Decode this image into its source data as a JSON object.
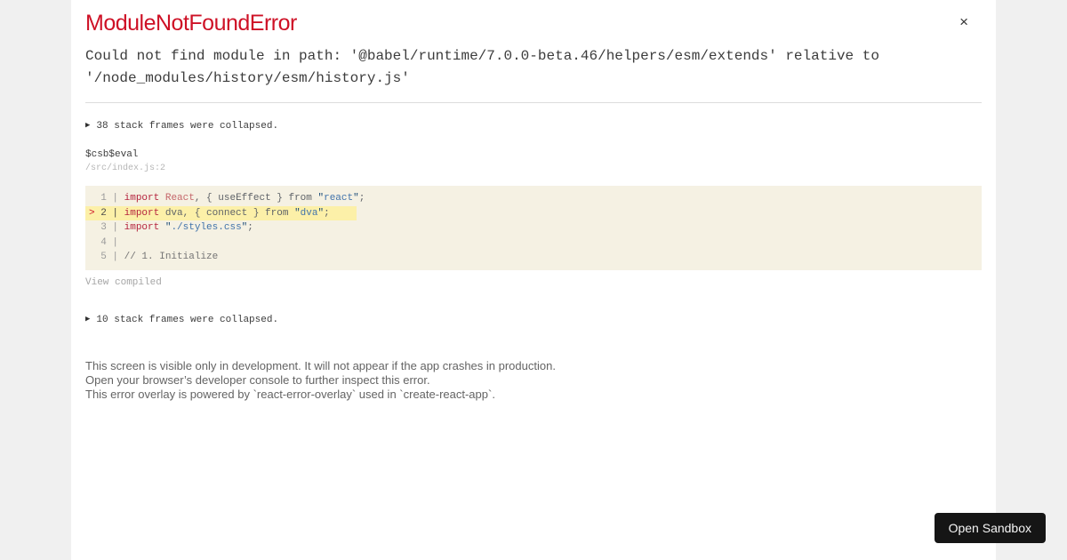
{
  "colors": {
    "page_background": "#f0f0f0",
    "dialog_background": "#ffffff",
    "error_red": "#ce1126",
    "code_frame_background": "#f5f1e3",
    "highlight_line_background": "#fcf0a8",
    "keyword_red": "#b5243e",
    "string_blue": "#4173ab",
    "button_background": "#151515"
  },
  "header": {
    "title": "ModuleNotFoundError",
    "close_label": "×"
  },
  "message": {
    "text": "Could not find module in path: '@babel/runtime/7.0.0-beta.46/helpers/esm/extends' relative to '/node_modules/history/esm/history.js'"
  },
  "stack": {
    "marker": "▶",
    "collapsed_top": "38 stack frames were collapsed.",
    "frame": {
      "function": "$csb$eval",
      "location": "/src/index.js:2"
    },
    "view_compiled": "View compiled",
    "collapsed_bottom": "10 stack frames were collapsed."
  },
  "code_frame": {
    "lines": [
      {
        "marked": false,
        "marker": " ",
        "prefix": " 1 | ",
        "tokens": [
          [
            "kw",
            "import"
          ],
          [
            "pln",
            " "
          ],
          [
            "cap",
            "React"
          ],
          [
            "pln",
            ", { useEffect } from "
          ],
          [
            "strq",
            "\""
          ],
          [
            "str",
            "react"
          ],
          [
            "strq",
            "\""
          ],
          [
            "pln",
            ";"
          ]
        ]
      },
      {
        "marked": true,
        "marker": ">",
        "prefix": " 2 | ",
        "tokens": [
          [
            "kw",
            "import"
          ],
          [
            "pln",
            " dva, { connect } from "
          ],
          [
            "strq",
            "\""
          ],
          [
            "str",
            "dva"
          ],
          [
            "strq",
            "\""
          ],
          [
            "pln",
            ";"
          ]
        ]
      },
      {
        "marked": false,
        "marker": " ",
        "prefix": " 3 | ",
        "tokens": [
          [
            "kw",
            "import"
          ],
          [
            "pln",
            " "
          ],
          [
            "strq",
            "\""
          ],
          [
            "str",
            "./styles.css"
          ],
          [
            "strq",
            "\""
          ],
          [
            "pln",
            ";"
          ]
        ]
      },
      {
        "marked": false,
        "marker": " ",
        "prefix": " 4 |",
        "tokens": []
      },
      {
        "marked": false,
        "marker": " ",
        "prefix": " 5 | ",
        "tokens": [
          [
            "cmt",
            "// 1. Initialize"
          ]
        ]
      }
    ]
  },
  "footer": {
    "lines": [
      "This screen is visible only in development. It will not appear if the app crashes in production.",
      "Open your browser’s developer console to further inspect this error.",
      "This error overlay is powered by `react-error-overlay` used in `create-react-app`."
    ]
  },
  "open_sandbox": {
    "label": "Open Sandbox"
  }
}
